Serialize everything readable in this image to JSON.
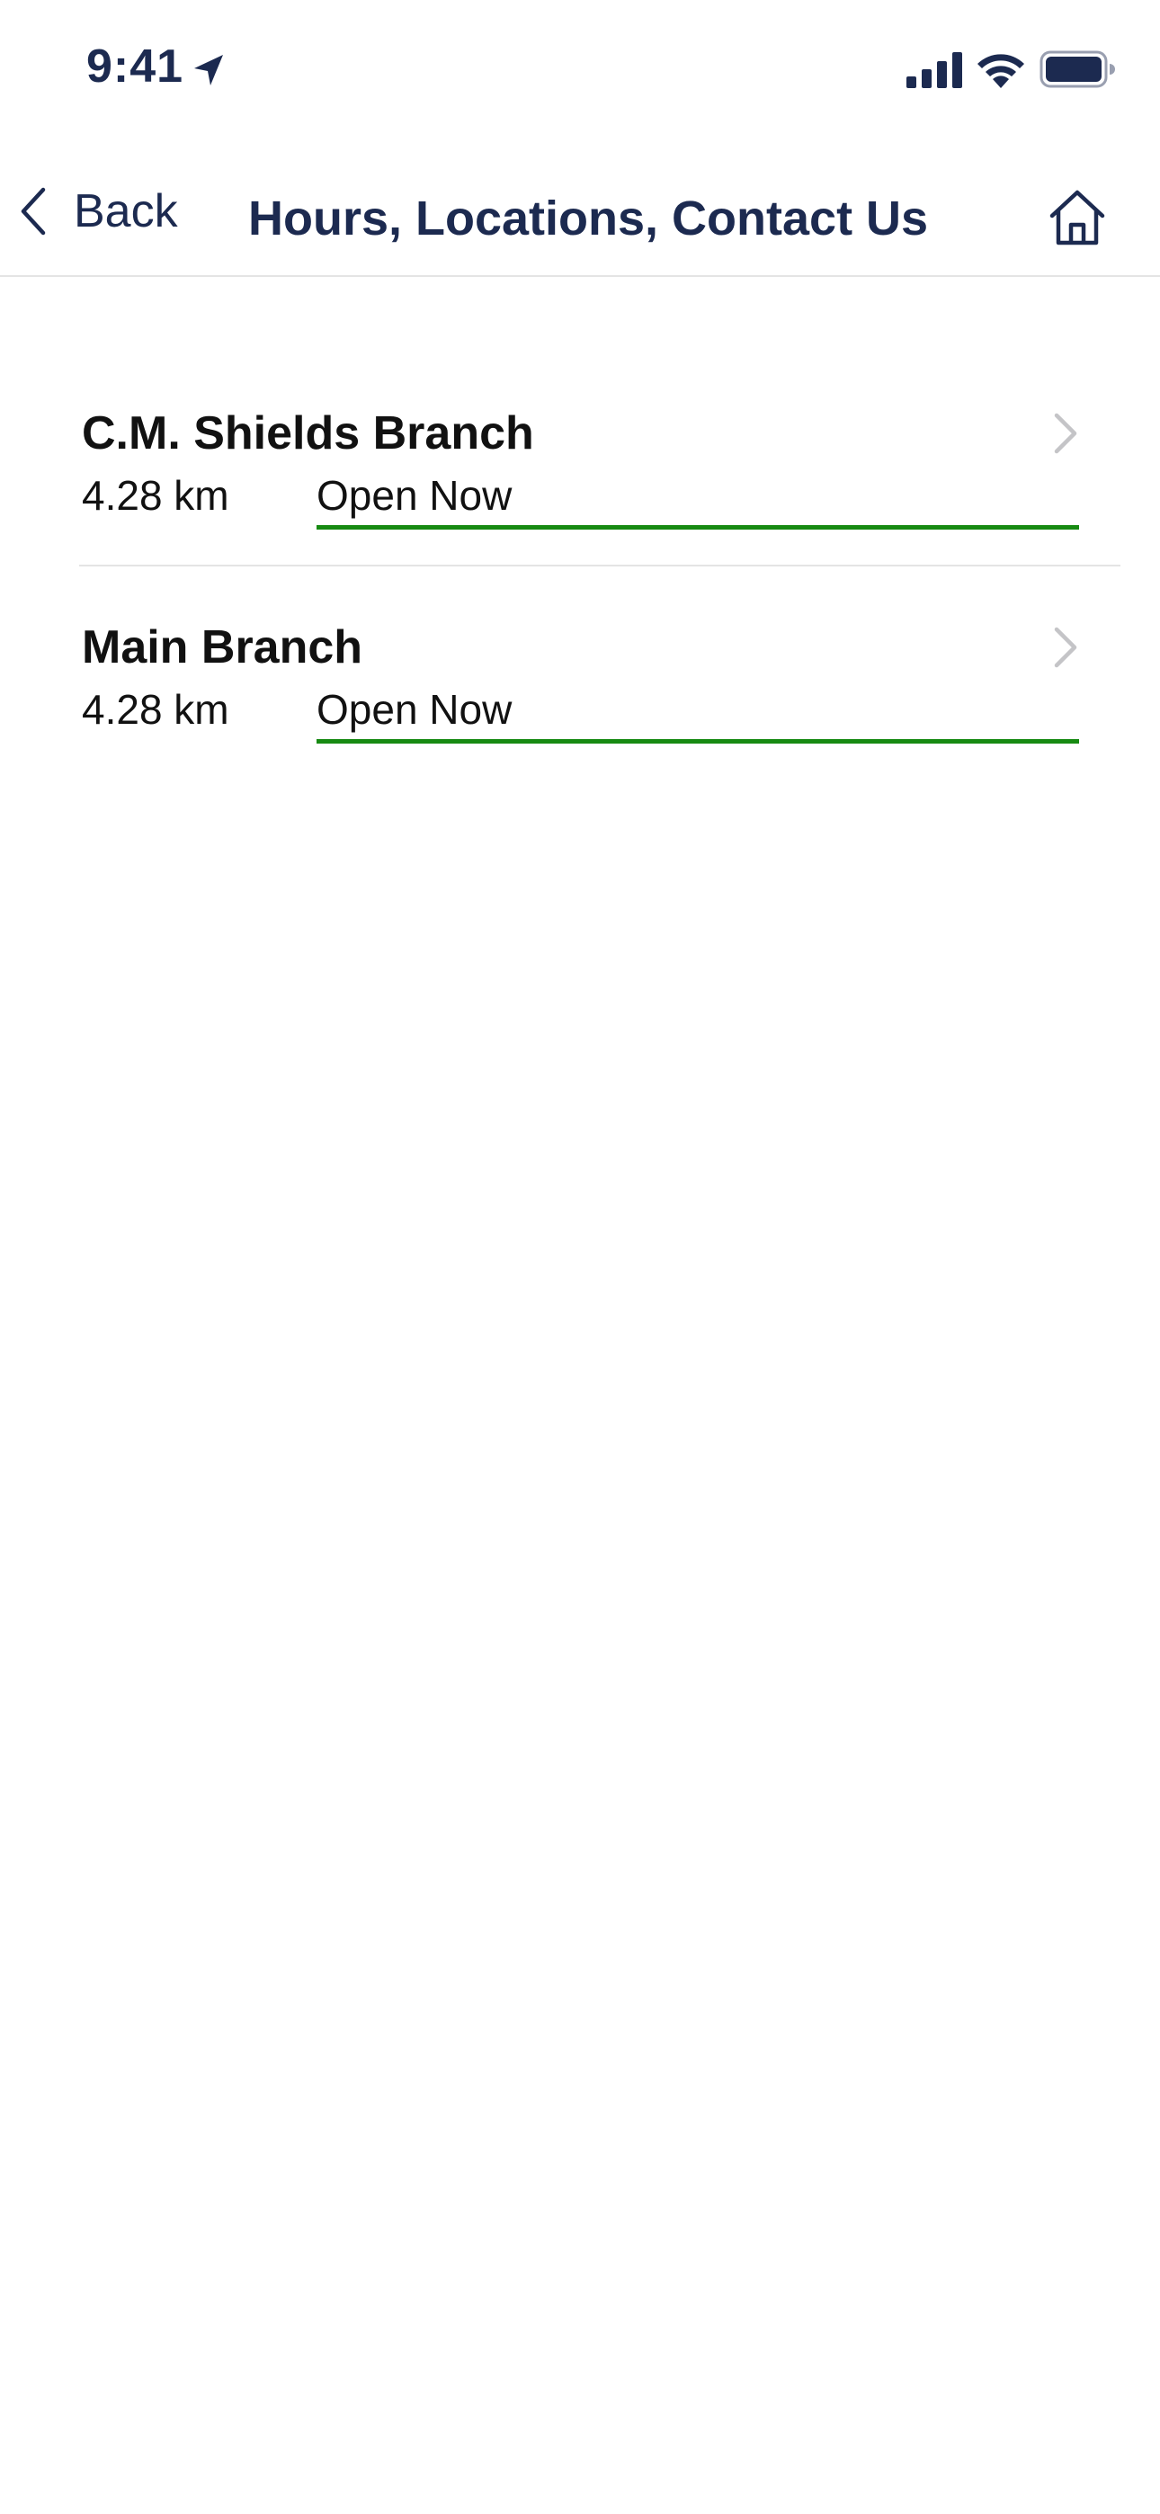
{
  "colors": {
    "navy": "#1c2a50",
    "text": "#111111",
    "open_green": "#178a12",
    "chevron_gray": "#c4c4c7",
    "divider": "#e4e4e4"
  },
  "status_bar": {
    "time": "9:41",
    "icons": [
      "location-arrow-icon",
      "cellular-signal-icon",
      "wifi-icon",
      "battery-icon"
    ]
  },
  "nav": {
    "back_label": "Back",
    "title": "Hours, Locations, Contact Us",
    "back_icon": "chevron-left-icon",
    "home_icon": "home-icon"
  },
  "branches": [
    {
      "name": "C.M. Shields Branch",
      "distance": "4.28 km",
      "status": "Open Now"
    },
    {
      "name": "Main Branch",
      "distance": "4.28 km",
      "status": "Open Now"
    }
  ]
}
